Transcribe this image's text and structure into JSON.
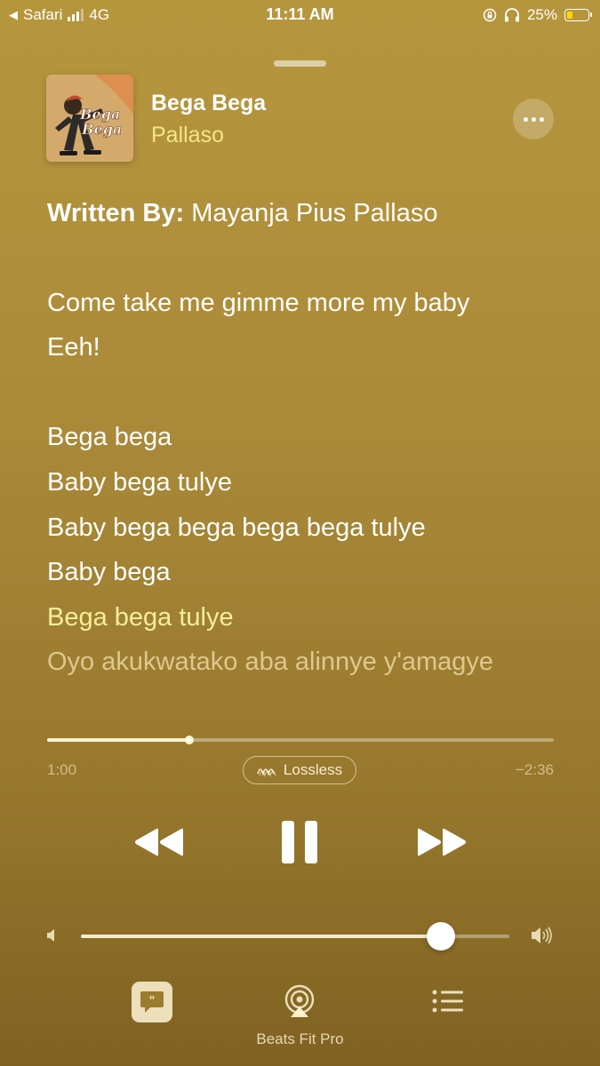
{
  "status_bar": {
    "back_app": "Safari",
    "network": "4G",
    "time": "11:11 AM",
    "battery_percent": "25%",
    "battery_level": 0.25
  },
  "now_playing": {
    "title": "Bega Bega",
    "artist": "Pallaso",
    "artwork_text": [
      "Bega",
      "Bega"
    ]
  },
  "lyrics": {
    "credit_label": "Written By:",
    "credit_value": " Mayanja Pius Pallaso",
    "lines": [
      "Come take me gimme more my baby",
      "Eeh!",
      "Bega bega",
      "Baby bega tulye",
      "Baby bega bega bega bega tulye",
      "Baby bega",
      "Bega bega tulye",
      "Oyo akukwatako aba alinnye y'amagye"
    ]
  },
  "playback": {
    "elapsed": "1:00",
    "remaining": "−2:36",
    "progress": 0.28,
    "badge": "Lossless",
    "volume": 0.84
  },
  "bottom_bar": {
    "device_label": "Beats Fit Pro"
  },
  "colors": {
    "accent_yellow": "#f4e58a",
    "background_top": "#b6963d",
    "background_bottom": "#7f6222"
  }
}
